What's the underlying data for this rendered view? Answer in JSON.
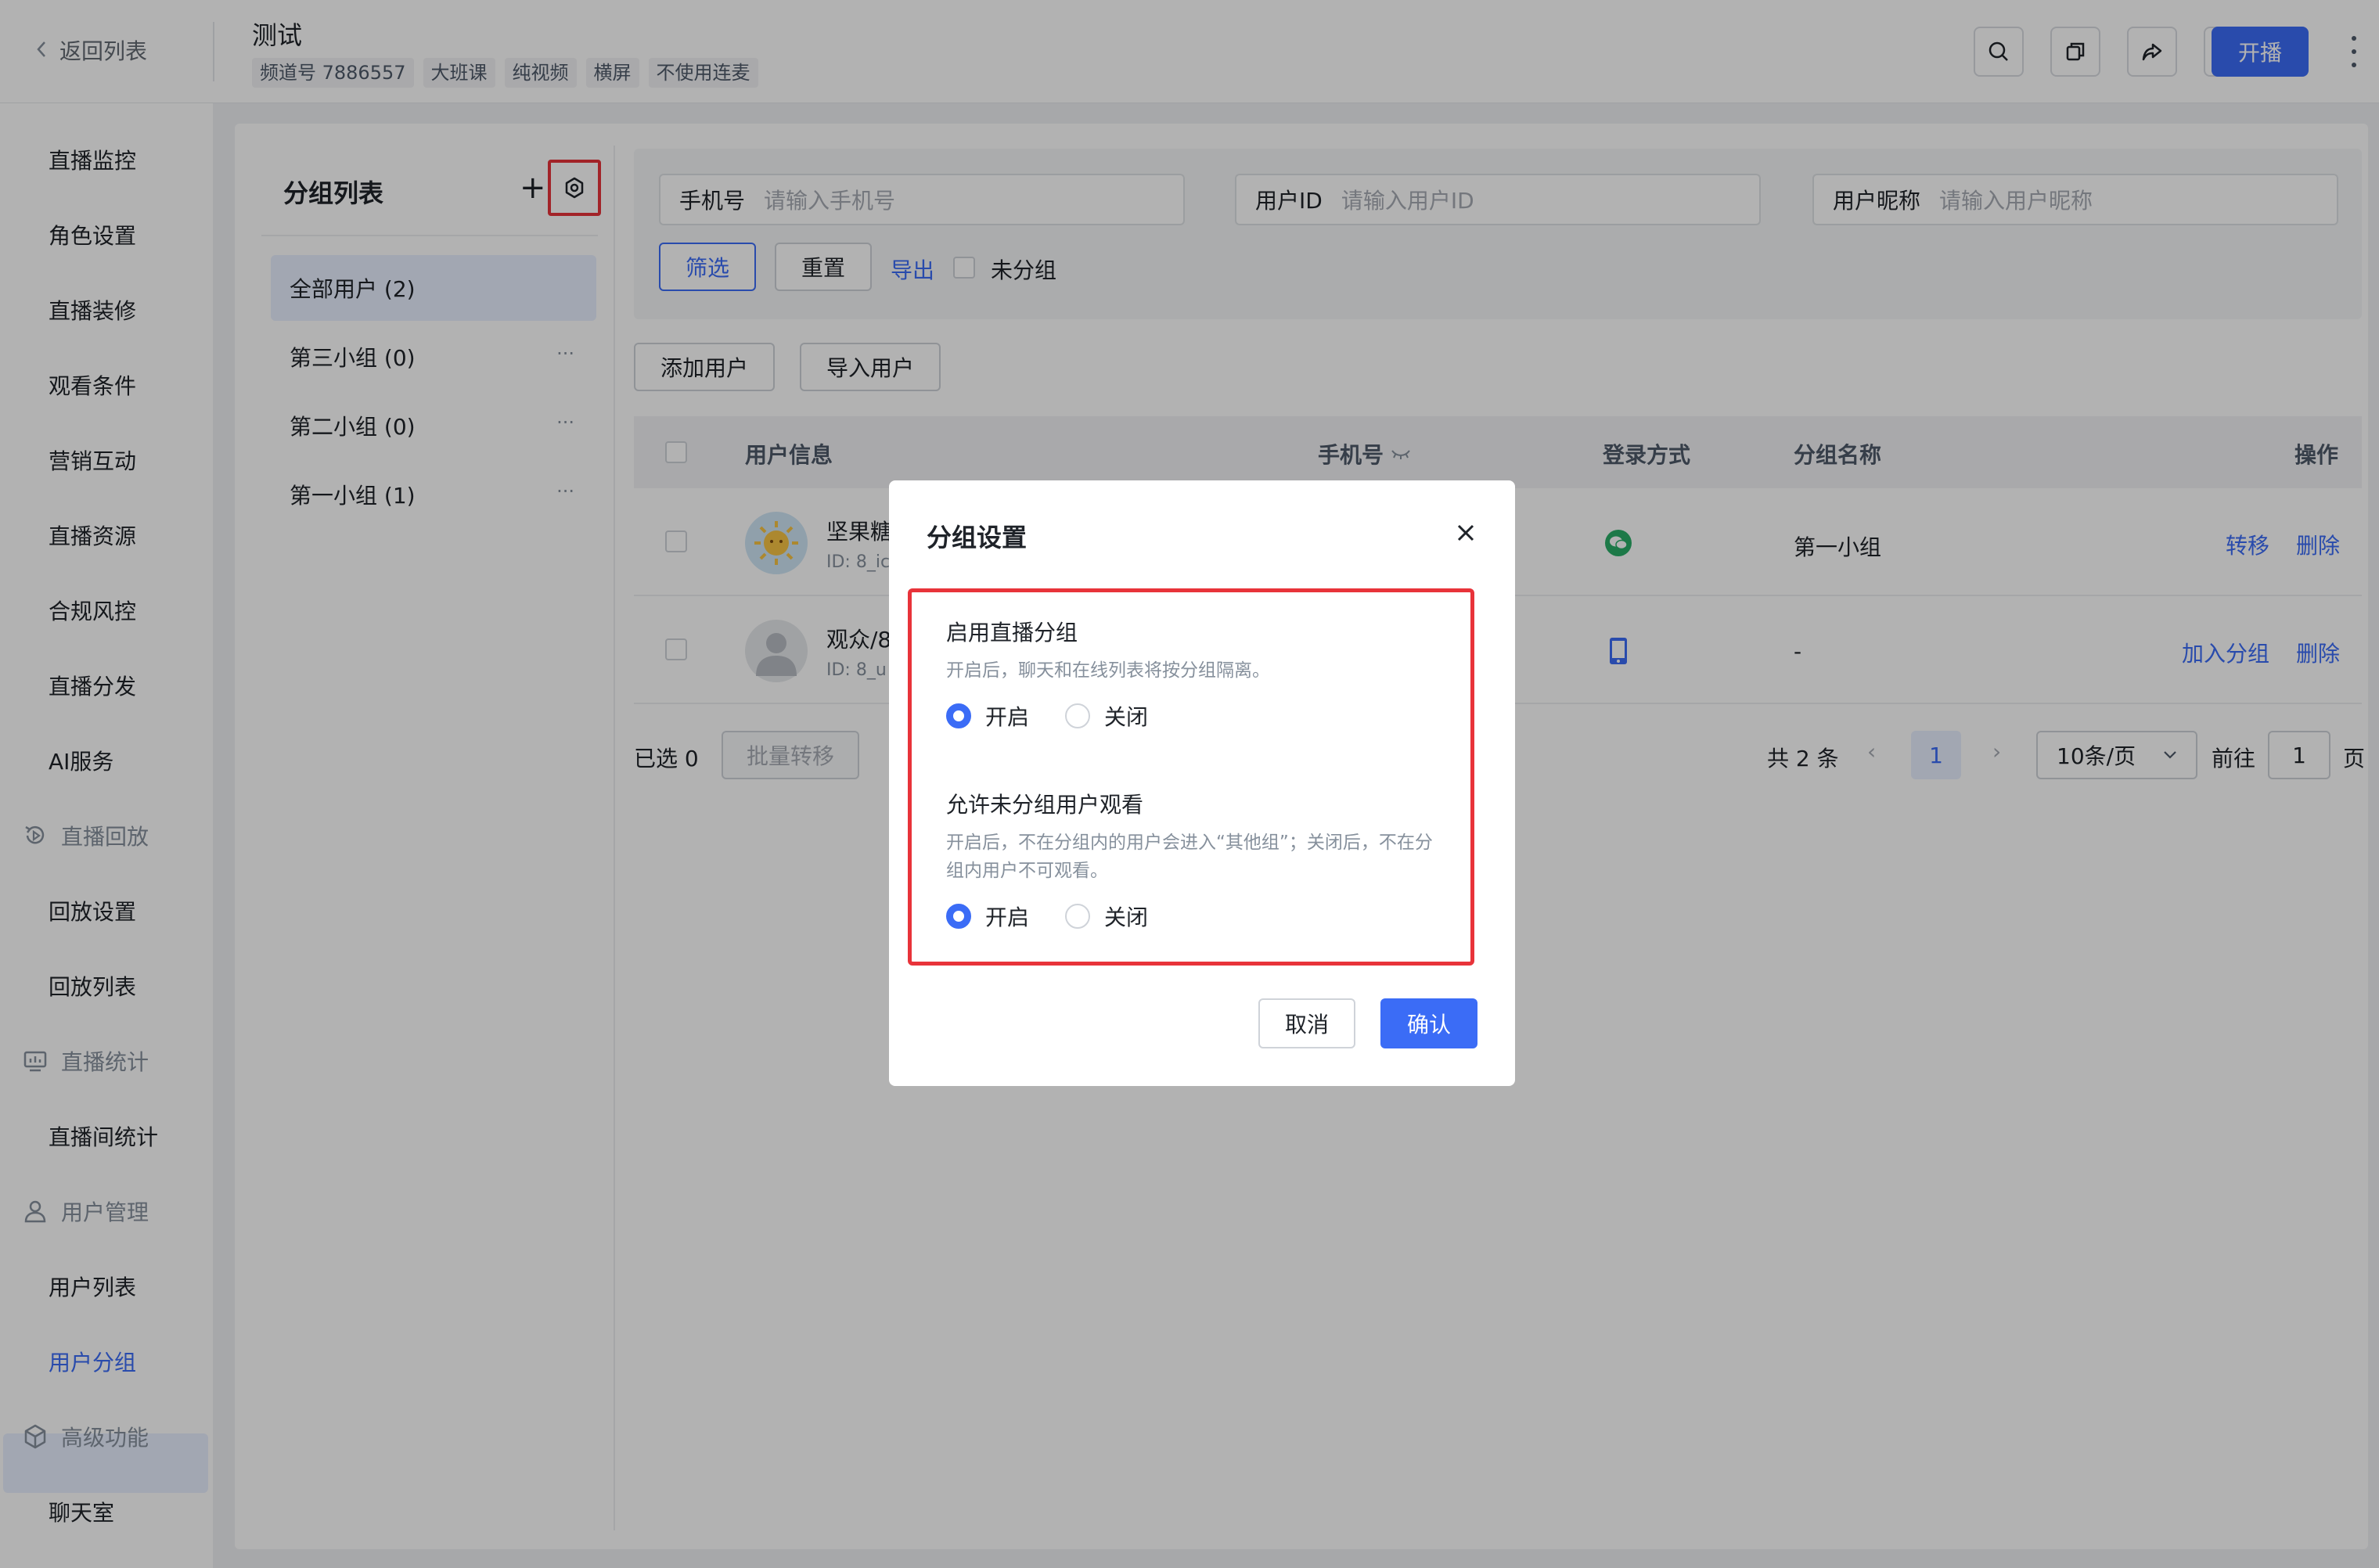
{
  "header": {
    "back_label": "返回列表",
    "title": "测试",
    "tags": [
      "频道号 7886557",
      "大班课",
      "纯视频",
      "横屏",
      "不使用连麦"
    ],
    "live_button": "开播"
  },
  "sidebar": {
    "items": [
      {
        "label": "直播监控"
      },
      {
        "label": "角色设置"
      },
      {
        "label": "直播装修"
      },
      {
        "label": "观看条件"
      },
      {
        "label": "营销互动"
      },
      {
        "label": "直播资源"
      },
      {
        "label": "合规风控"
      },
      {
        "label": "直播分发"
      },
      {
        "label": "AI服务"
      }
    ],
    "group_replay": "直播回放",
    "replay_items": [
      {
        "label": "回放设置"
      },
      {
        "label": "回放列表"
      }
    ],
    "group_stats": "直播统计",
    "stats_items": [
      {
        "label": "直播间统计"
      }
    ],
    "group_users": "用户管理",
    "user_items": [
      {
        "label": "用户列表"
      },
      {
        "label": "用户分组"
      }
    ],
    "group_advanced": "高级功能",
    "advanced_items": [
      {
        "label": "聊天室"
      }
    ]
  },
  "groups": {
    "title": "分组列表",
    "items": [
      {
        "label": "全部用户 (2)"
      },
      {
        "label": "第三小组 (0)"
      },
      {
        "label": "第二小组 (0)"
      },
      {
        "label": "第一小组 (1)"
      }
    ],
    "dots": "···"
  },
  "filters": {
    "phone_label": "手机号",
    "phone_placeholder": "请输入手机号",
    "uid_label": "用户ID",
    "uid_placeholder": "请输入用户ID",
    "nick_label": "用户昵称",
    "nick_placeholder": "请输入用户昵称",
    "filter_btn": "筛选",
    "reset_btn": "重置",
    "export_link": "导出",
    "ungrouped_label": "未分组"
  },
  "actions": {
    "add_user": "添加用户",
    "import_user": "导入用户"
  },
  "table": {
    "headers": {
      "user": "用户信息",
      "phone": "手机号",
      "login": "登录方式",
      "group": "分组名称",
      "ops": "操作"
    },
    "rows": [
      {
        "name": "坚果糖",
        "id": "ID: 8_ic",
        "login_icon": "wechat-icon",
        "group": "第一小组",
        "op1": "转移",
        "op2": "删除"
      },
      {
        "name": "观众/8",
        "id": "ID: 8_u",
        "login_icon": "mobile-icon",
        "group": "-",
        "op1": "加入分组",
        "op2": "删除"
      }
    ]
  },
  "footer": {
    "selected_label": "已选",
    "selected_count": "0",
    "batch_btn": "批量转移",
    "total": "共 2 条",
    "page": "1",
    "page_size": "10条/页",
    "goto_label": "前往",
    "goto_value": "1",
    "page_suffix": "页"
  },
  "dialog": {
    "title": "分组设置",
    "sec1_title": "启用直播分组",
    "sec1_desc": "开启后，聊天和在线列表将按分组隔离。",
    "sec2_title": "允许未分组用户观看",
    "sec2_desc": "开启后，不在分组内的用户会进入“其他组”；关闭后，不在分组内用户不可观看。",
    "on_label": "开启",
    "off_label": "关闭",
    "sec1_value": "开启",
    "sec2_value": "开启",
    "cancel": "取消",
    "confirm": "确认"
  },
  "colors": {
    "accent": "#3b6cf6",
    "highlight": "#e8333a",
    "wechat": "#2aae67"
  }
}
